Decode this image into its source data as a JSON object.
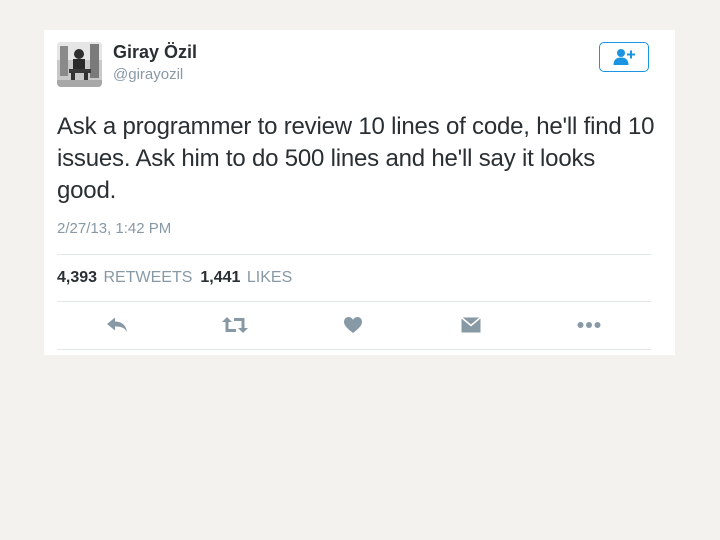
{
  "tweet": {
    "author_name": "Giray Özil",
    "author_handle": "@girayozil",
    "text": "Ask a programmer to review 10 lines of code, he'll find 10 issues. Ask him to do 500 lines and he'll say it looks good.",
    "timestamp": "2/27/13, 1:42 PM",
    "retweet_count": "4,393",
    "retweet_label": "RETWEETS",
    "like_count": "1,441",
    "like_label": "LIKES"
  },
  "icons": {
    "follow": "add-user-icon",
    "reply": "reply-icon",
    "retweet": "retweet-icon",
    "like": "heart-icon",
    "message": "envelope-icon",
    "more": "more-dots-icon"
  },
  "colors": {
    "background": "#f3f2ef",
    "card": "#ffffff",
    "accent": "#1b95e0",
    "text_primary": "#292f33",
    "text_secondary": "#8899a6",
    "icon": "#8899a6",
    "divider": "#e1e8ed"
  }
}
